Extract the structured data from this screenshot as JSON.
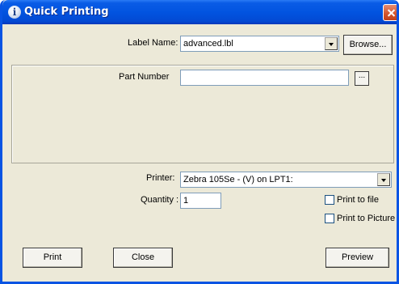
{
  "window": {
    "title": "Quick Printing",
    "icon": "info-icon",
    "close_icon": "close-icon"
  },
  "label_name": {
    "label": "Label Name:",
    "value": "advanced.lbl",
    "browse_label": "Browse..."
  },
  "variables": {
    "part_number_label": "Part Number",
    "part_number_value": "",
    "ellipsis_label": "..."
  },
  "printer": {
    "label": "Printer:",
    "value": "Zebra 105Se - (V) on LPT1:"
  },
  "quantity": {
    "label": "Quantity :",
    "value": "1"
  },
  "options": {
    "print_to_file": {
      "label": "Print to file",
      "checked": false
    },
    "print_to_picture": {
      "label": "Print to Picture",
      "checked": false
    }
  },
  "buttons": {
    "print": "Print",
    "close": "Close",
    "preview": "Preview"
  }
}
